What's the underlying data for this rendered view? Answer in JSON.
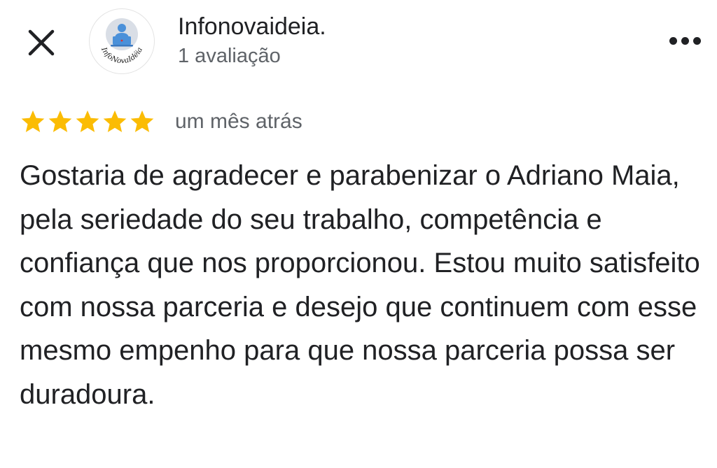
{
  "header": {
    "reviewer_name": "Infonovaideia.",
    "review_count": "1 avaliação",
    "avatar_logo_text": "InfoNovaIdéia"
  },
  "review": {
    "rating": 5,
    "max_rating": 5,
    "time": "um mês atrás",
    "text": "Gostaria de agradecer e parabenizar o Adriano Maia, pela seriedade do seu trabalho, competência e confiança que nos proporcionou. Estou muito satisfeito com nossa parceria e desejo que continuem com esse mesmo empenho para que nossa parceria possa ser duradoura."
  },
  "icons": {
    "close": "close-icon",
    "more": "more-options-icon",
    "star": "star-icon"
  },
  "colors": {
    "star": "#fbbc04",
    "text_primary": "#202124",
    "text_secondary": "#5f6368",
    "avatar_person": "#4a90d9",
    "avatar_bg": "#d9dee6"
  }
}
